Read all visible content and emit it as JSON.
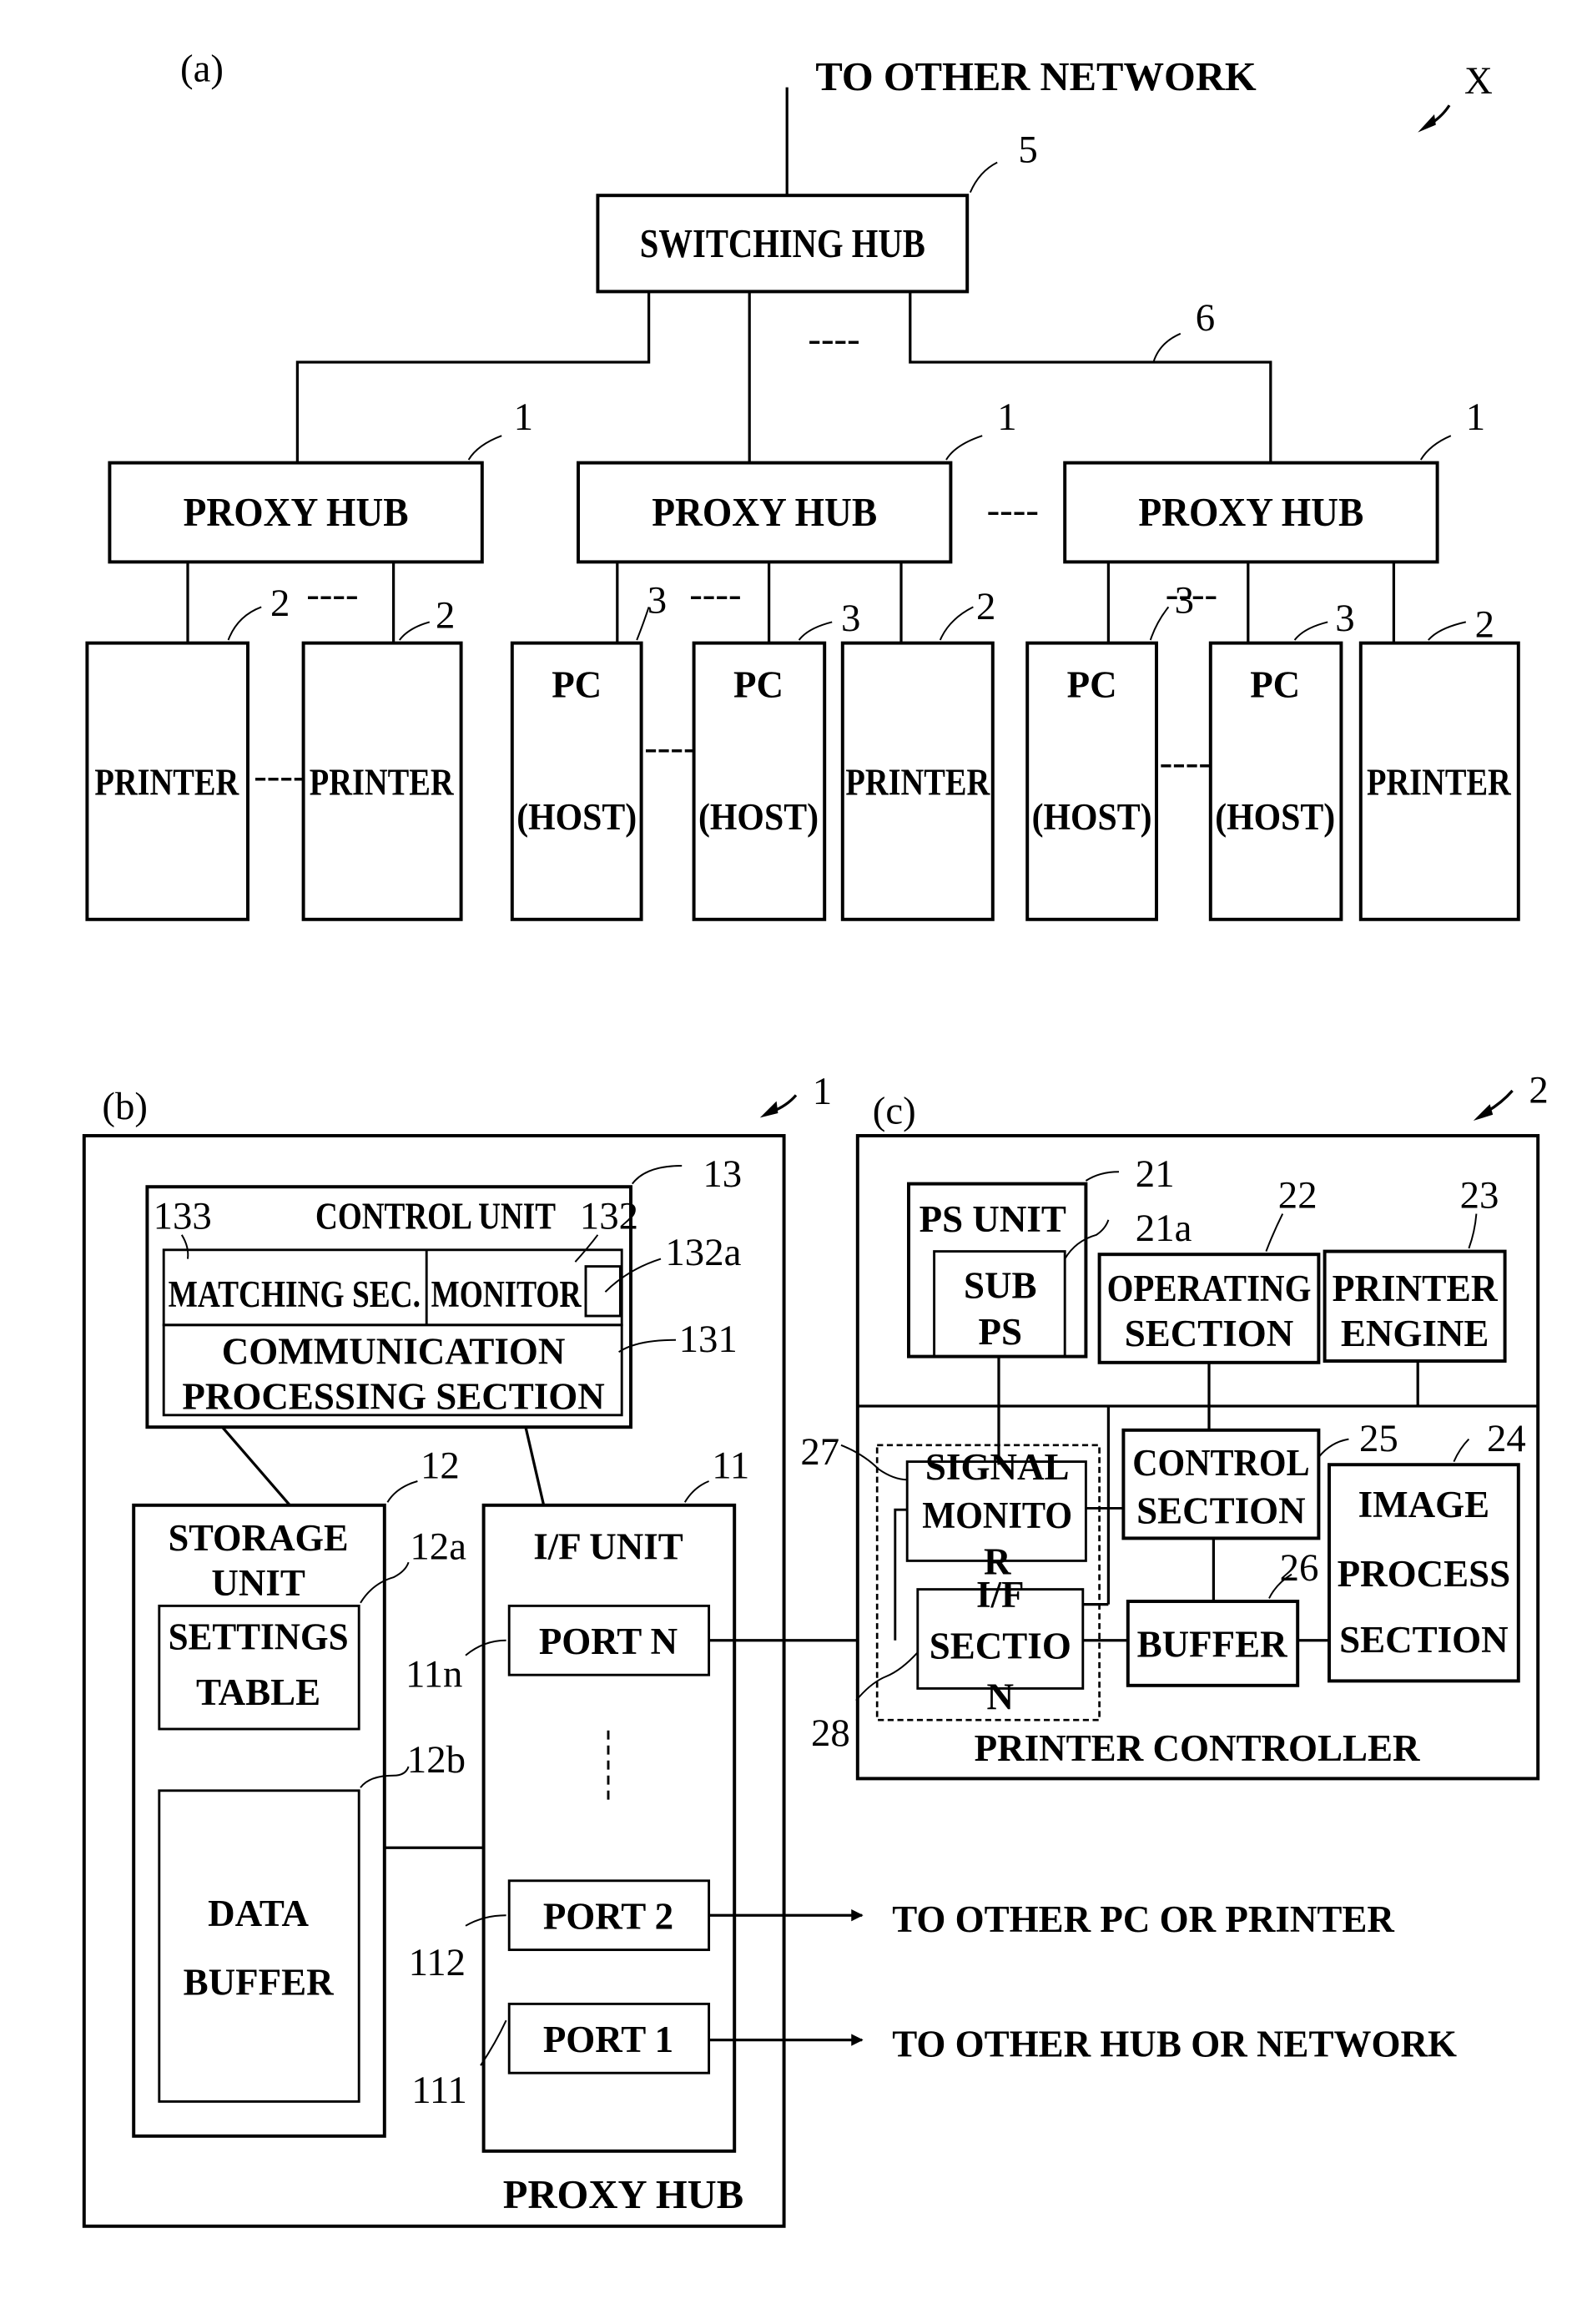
{
  "figure": {
    "panel_a": {
      "caption": "(a)",
      "system_ref": "X",
      "uplink_label": "TO OTHER NETWORK",
      "switching_hub": {
        "label": "SWITCHING HUB",
        "ref": "5"
      },
      "network_ref": "6",
      "ellipsis": "----",
      "proxy_hubs": [
        {
          "label": "PROXY HUB",
          "ref": "1"
        },
        {
          "label": "PROXY HUB",
          "ref": "1"
        },
        {
          "label": "PROXY HUB",
          "ref": "1"
        }
      ],
      "devices": [
        {
          "type": "printer",
          "label": "PRINTER",
          "ref": "2"
        },
        {
          "type": "printer",
          "label": "PRINTER",
          "ref": "2"
        },
        {
          "type": "pc",
          "line1": "PC",
          "line2": "(HOST)",
          "ref": "3"
        },
        {
          "type": "pc",
          "line1": "PC",
          "line2": "(HOST)",
          "ref": "3"
        },
        {
          "type": "printer",
          "label": "PRINTER",
          "ref": "2"
        },
        {
          "type": "pc",
          "line1": "PC",
          "line2": "(HOST)",
          "ref": "3"
        },
        {
          "type": "pc",
          "line1": "PC",
          "line2": "(HOST)",
          "ref": "3"
        },
        {
          "type": "printer",
          "label": "PRINTER",
          "ref": "2"
        }
      ]
    },
    "panel_b": {
      "caption": "(b)",
      "ref": "1",
      "title": "PROXY HUB",
      "control_unit": {
        "label": "CONTROL UNIT",
        "ref": "13",
        "matching": {
          "label": "MATCHING SEC.",
          "ref": "133"
        },
        "monitor": {
          "label": "MONITOR",
          "ref": "132",
          "sub_ref": "132a"
        },
        "comm": {
          "line1": "COMMUNICATION",
          "line2": "PROCESSING SECTION",
          "ref": "131"
        }
      },
      "storage_unit": {
        "line1": "STORAGE",
        "line2": "UNIT",
        "ref": "12",
        "settings_table": {
          "line1": "SETTINGS",
          "line2": "TABLE",
          "ref": "12a"
        },
        "data_buffer": {
          "line1": "DATA",
          "line2": "BUFFER",
          "ref": "12b"
        }
      },
      "if_unit": {
        "label": "I/F UNIT",
        "ref": "11",
        "ports": [
          {
            "label": "PORT N",
            "ref": "11n"
          },
          {
            "label": "PORT 2",
            "ref": "112",
            "destination": "TO OTHER PC OR PRINTER"
          },
          {
            "label": "PORT 1",
            "ref": "111",
            "destination": "TO OTHER HUB OR NETWORK"
          }
        ]
      }
    },
    "panel_c": {
      "caption": "(c)",
      "ref": "2",
      "ps_unit": {
        "label": "PS UNIT",
        "ref": "21",
        "sub": {
          "line1": "SUB",
          "line2": "PS",
          "ref": "21a"
        }
      },
      "operating_section": {
        "line1": "OPERATING",
        "line2": "SECTION",
        "ref": "22"
      },
      "printer_engine": {
        "line1": "PRINTER",
        "line2": "ENGINE",
        "ref": "23"
      },
      "image_process": {
        "line1": "IMAGE",
        "line2": "PROCESS",
        "line3": "SECTION",
        "ref": "24"
      },
      "control_section": {
        "line1": "CONTROL",
        "line2": "SECTION",
        "ref": "25"
      },
      "buffer": {
        "label": "BUFFER",
        "ref": "26"
      },
      "signal_monitor": {
        "line1": "SIGNAL",
        "line2": "MONITO",
        "line3": "R",
        "ref": "27"
      },
      "if_section": {
        "line1": "I/F",
        "line2": "SECTIO",
        "line3": "N",
        "ref": "28"
      },
      "printer_controller": "PRINTER CONTROLLER"
    }
  }
}
